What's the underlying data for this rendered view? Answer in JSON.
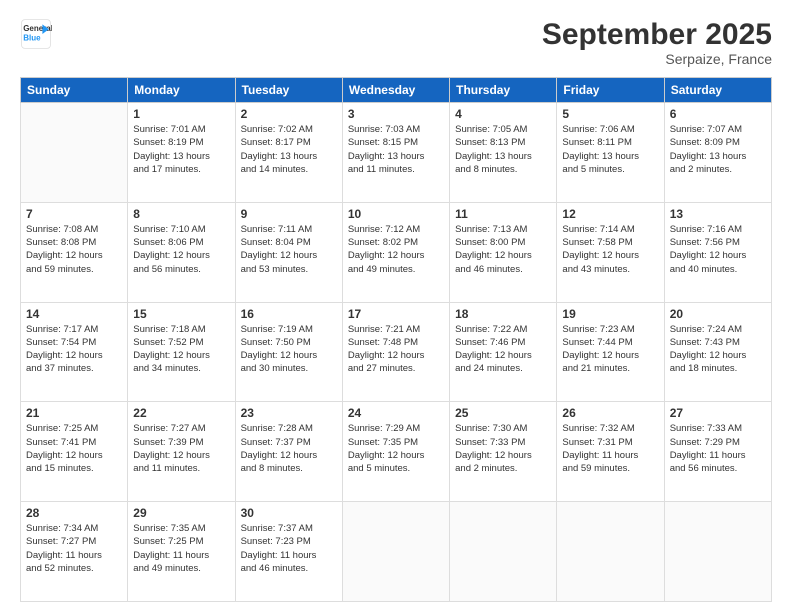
{
  "logo": {
    "line1": "General",
    "line2": "Blue"
  },
  "title": "September 2025",
  "subtitle": "Serpaize, France",
  "header_days": [
    "Sunday",
    "Monday",
    "Tuesday",
    "Wednesday",
    "Thursday",
    "Friday",
    "Saturday"
  ],
  "weeks": [
    [
      {
        "num": "",
        "info": ""
      },
      {
        "num": "1",
        "info": "Sunrise: 7:01 AM\nSunset: 8:19 PM\nDaylight: 13 hours\nand 17 minutes."
      },
      {
        "num": "2",
        "info": "Sunrise: 7:02 AM\nSunset: 8:17 PM\nDaylight: 13 hours\nand 14 minutes."
      },
      {
        "num": "3",
        "info": "Sunrise: 7:03 AM\nSunset: 8:15 PM\nDaylight: 13 hours\nand 11 minutes."
      },
      {
        "num": "4",
        "info": "Sunrise: 7:05 AM\nSunset: 8:13 PM\nDaylight: 13 hours\nand 8 minutes."
      },
      {
        "num": "5",
        "info": "Sunrise: 7:06 AM\nSunset: 8:11 PM\nDaylight: 13 hours\nand 5 minutes."
      },
      {
        "num": "6",
        "info": "Sunrise: 7:07 AM\nSunset: 8:09 PM\nDaylight: 13 hours\nand 2 minutes."
      }
    ],
    [
      {
        "num": "7",
        "info": "Sunrise: 7:08 AM\nSunset: 8:08 PM\nDaylight: 12 hours\nand 59 minutes."
      },
      {
        "num": "8",
        "info": "Sunrise: 7:10 AM\nSunset: 8:06 PM\nDaylight: 12 hours\nand 56 minutes."
      },
      {
        "num": "9",
        "info": "Sunrise: 7:11 AM\nSunset: 8:04 PM\nDaylight: 12 hours\nand 53 minutes."
      },
      {
        "num": "10",
        "info": "Sunrise: 7:12 AM\nSunset: 8:02 PM\nDaylight: 12 hours\nand 49 minutes."
      },
      {
        "num": "11",
        "info": "Sunrise: 7:13 AM\nSunset: 8:00 PM\nDaylight: 12 hours\nand 46 minutes."
      },
      {
        "num": "12",
        "info": "Sunrise: 7:14 AM\nSunset: 7:58 PM\nDaylight: 12 hours\nand 43 minutes."
      },
      {
        "num": "13",
        "info": "Sunrise: 7:16 AM\nSunset: 7:56 PM\nDaylight: 12 hours\nand 40 minutes."
      }
    ],
    [
      {
        "num": "14",
        "info": "Sunrise: 7:17 AM\nSunset: 7:54 PM\nDaylight: 12 hours\nand 37 minutes."
      },
      {
        "num": "15",
        "info": "Sunrise: 7:18 AM\nSunset: 7:52 PM\nDaylight: 12 hours\nand 34 minutes."
      },
      {
        "num": "16",
        "info": "Sunrise: 7:19 AM\nSunset: 7:50 PM\nDaylight: 12 hours\nand 30 minutes."
      },
      {
        "num": "17",
        "info": "Sunrise: 7:21 AM\nSunset: 7:48 PM\nDaylight: 12 hours\nand 27 minutes."
      },
      {
        "num": "18",
        "info": "Sunrise: 7:22 AM\nSunset: 7:46 PM\nDaylight: 12 hours\nand 24 minutes."
      },
      {
        "num": "19",
        "info": "Sunrise: 7:23 AM\nSunset: 7:44 PM\nDaylight: 12 hours\nand 21 minutes."
      },
      {
        "num": "20",
        "info": "Sunrise: 7:24 AM\nSunset: 7:43 PM\nDaylight: 12 hours\nand 18 minutes."
      }
    ],
    [
      {
        "num": "21",
        "info": "Sunrise: 7:25 AM\nSunset: 7:41 PM\nDaylight: 12 hours\nand 15 minutes."
      },
      {
        "num": "22",
        "info": "Sunrise: 7:27 AM\nSunset: 7:39 PM\nDaylight: 12 hours\nand 11 minutes."
      },
      {
        "num": "23",
        "info": "Sunrise: 7:28 AM\nSunset: 7:37 PM\nDaylight: 12 hours\nand 8 minutes."
      },
      {
        "num": "24",
        "info": "Sunrise: 7:29 AM\nSunset: 7:35 PM\nDaylight: 12 hours\nand 5 minutes."
      },
      {
        "num": "25",
        "info": "Sunrise: 7:30 AM\nSunset: 7:33 PM\nDaylight: 12 hours\nand 2 minutes."
      },
      {
        "num": "26",
        "info": "Sunrise: 7:32 AM\nSunset: 7:31 PM\nDaylight: 11 hours\nand 59 minutes."
      },
      {
        "num": "27",
        "info": "Sunrise: 7:33 AM\nSunset: 7:29 PM\nDaylight: 11 hours\nand 56 minutes."
      }
    ],
    [
      {
        "num": "28",
        "info": "Sunrise: 7:34 AM\nSunset: 7:27 PM\nDaylight: 11 hours\nand 52 minutes."
      },
      {
        "num": "29",
        "info": "Sunrise: 7:35 AM\nSunset: 7:25 PM\nDaylight: 11 hours\nand 49 minutes."
      },
      {
        "num": "30",
        "info": "Sunrise: 7:37 AM\nSunset: 7:23 PM\nDaylight: 11 hours\nand 46 minutes."
      },
      {
        "num": "",
        "info": ""
      },
      {
        "num": "",
        "info": ""
      },
      {
        "num": "",
        "info": ""
      },
      {
        "num": "",
        "info": ""
      }
    ]
  ]
}
